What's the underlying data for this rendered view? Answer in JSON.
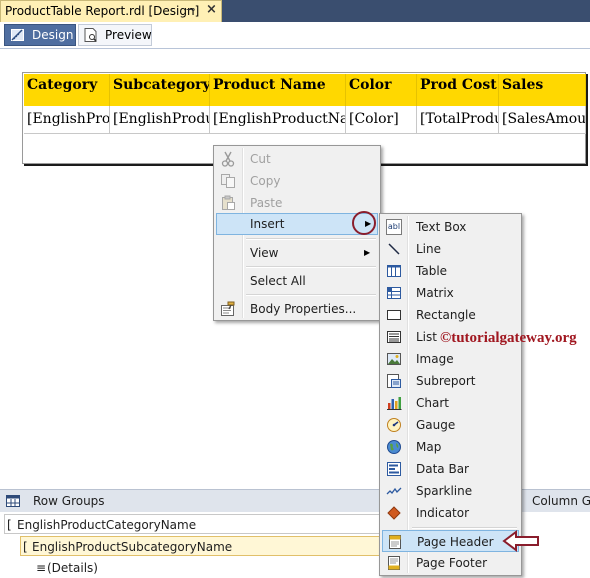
{
  "document_tab": {
    "title": "ProductTable Report.rdl [Design]",
    "pin_glyph": "⊸",
    "close_glyph": "×"
  },
  "view_tabs": {
    "design": "Design",
    "preview": "Preview"
  },
  "tablix": {
    "headers": [
      "Category",
      "Subcategory",
      "Product Name",
      "Color",
      "Prod Cost",
      "Sales"
    ],
    "cells": [
      "[EnglishPro",
      "[EnglishProdu",
      "[EnglishProductNa",
      "[Color]",
      "[TotalProdu",
      "[SalesAmou"
    ],
    "header_color": "#ffd800"
  },
  "context_menu": {
    "items": [
      {
        "label": "Cut",
        "icon": "scissors-icon",
        "enabled": false
      },
      {
        "label": "Copy",
        "icon": "copy-icon",
        "enabled": false
      },
      {
        "label": "Paste",
        "icon": "paste-icon",
        "enabled": false
      },
      {
        "label": "Insert",
        "icon": "",
        "enabled": true,
        "submenu": true,
        "highlighted": true
      },
      {
        "label": "View",
        "icon": "",
        "enabled": true,
        "submenu": true
      },
      {
        "label": "Select All",
        "icon": "",
        "enabled": true
      },
      {
        "label": "Body Properties...",
        "icon": "properties-icon",
        "enabled": true
      }
    ]
  },
  "insert_menu": {
    "items": [
      {
        "label": "Text Box",
        "icon": "textbox-icon"
      },
      {
        "label": "Line",
        "icon": "line-icon"
      },
      {
        "label": "Table",
        "icon": "table-icon"
      },
      {
        "label": "Matrix",
        "icon": "matrix-icon"
      },
      {
        "label": "Rectangle",
        "icon": "rectangle-icon"
      },
      {
        "label": "List",
        "icon": "list-icon"
      },
      {
        "label": "Image",
        "icon": "image-icon"
      },
      {
        "label": "Subreport",
        "icon": "subreport-icon"
      },
      {
        "label": "Chart",
        "icon": "chart-icon"
      },
      {
        "label": "Gauge",
        "icon": "gauge-icon"
      },
      {
        "label": "Map",
        "icon": "map-icon"
      },
      {
        "label": "Data Bar",
        "icon": "databar-icon"
      },
      {
        "label": "Sparkline",
        "icon": "sparkline-icon"
      },
      {
        "label": "Indicator",
        "icon": "indicator-icon"
      },
      {
        "label": "Page Header",
        "icon": "page-header-icon",
        "highlighted": true
      },
      {
        "label": "Page Footer",
        "icon": "page-footer-icon"
      }
    ]
  },
  "textbox_icon_text": "abl",
  "watermark": "©tutorialgateway.org",
  "groups": {
    "row_groups_label": "Row Groups",
    "column_groups_label": "Column Gr",
    "rows": [
      {
        "bracket": "[",
        "label": "EnglishProductCategoryName"
      },
      {
        "bracket": "[",
        "label": "EnglishProductSubcategoryName"
      },
      {
        "bracket": "≡",
        "label": "(Details)"
      }
    ]
  },
  "colors": {
    "accent_annotation": "#8a1d2c",
    "menu_highlight": "#cde4f7"
  }
}
